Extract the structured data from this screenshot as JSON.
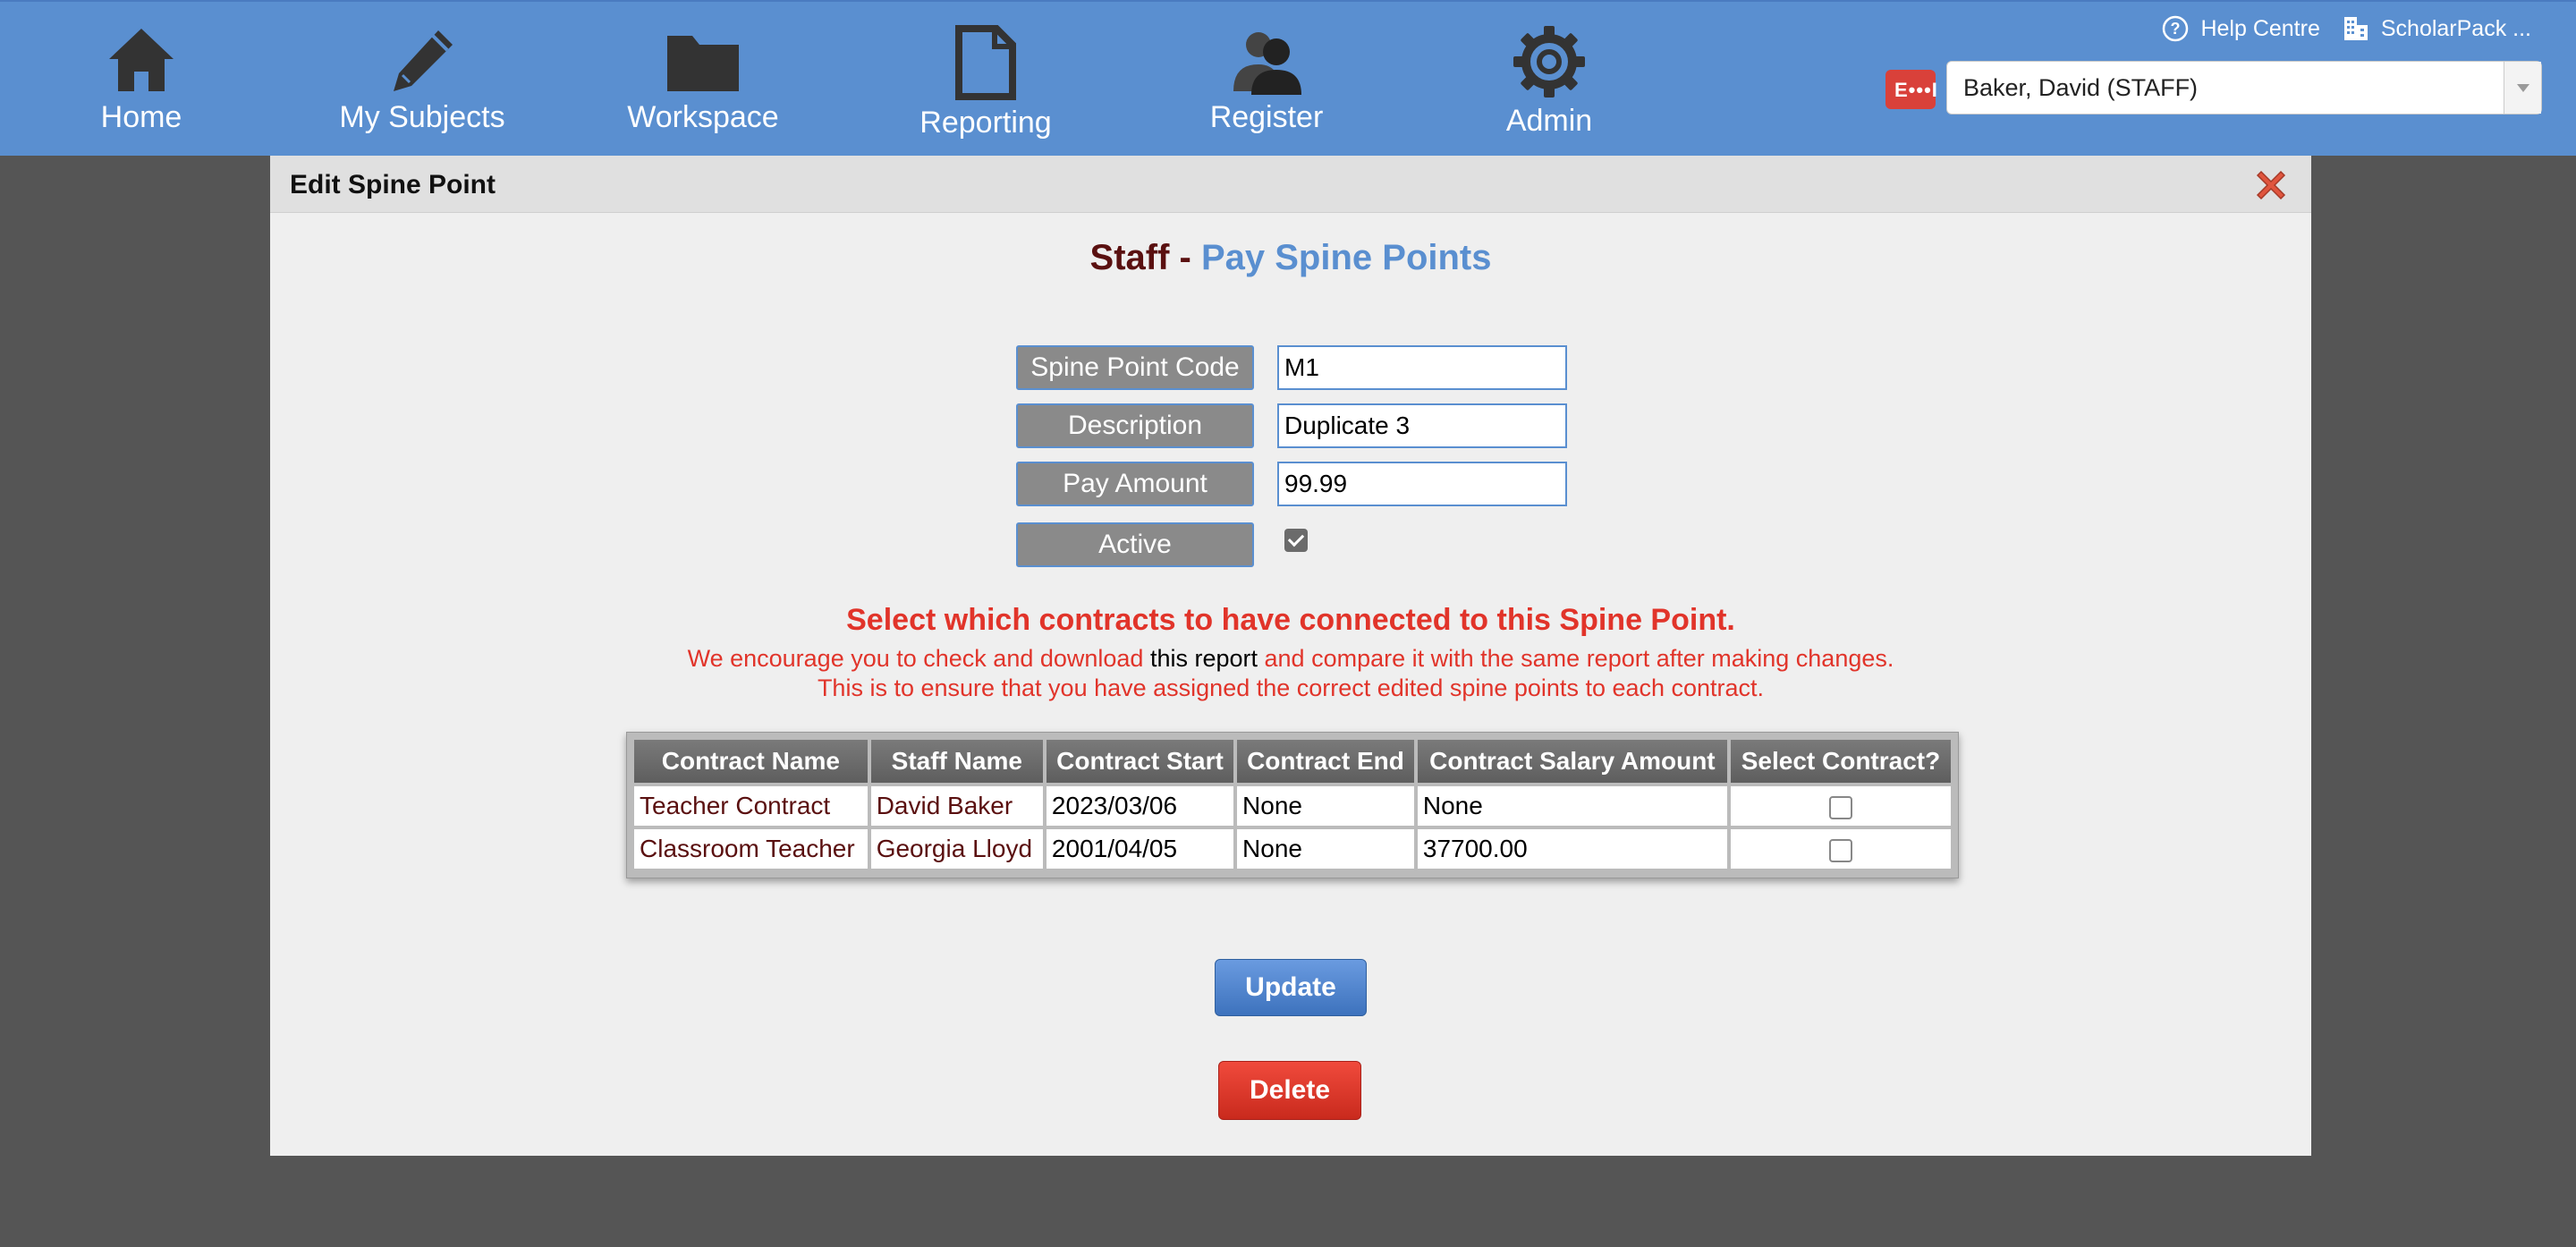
{
  "nav": {
    "items": [
      {
        "label": "Home",
        "icon": "home-icon"
      },
      {
        "label": "My Subjects",
        "icon": "pencil-icon"
      },
      {
        "label": "Workspace",
        "icon": "folder-icon"
      },
      {
        "label": "Reporting",
        "icon": "document-icon"
      },
      {
        "label": "Register",
        "icon": "users-icon"
      },
      {
        "label": "Admin",
        "icon": "gear-icon"
      }
    ],
    "help_label": "Help Centre",
    "school_label": "ScholarPack ...",
    "user_select_value": "Baker, David (STAFF)"
  },
  "modal": {
    "title": "Edit Spine Point",
    "page_title_part1": "Staff - ",
    "page_title_part2": "Pay Spine Points"
  },
  "form": {
    "code_label": "Spine Point Code",
    "code_value": "M1",
    "description_label": "Description",
    "description_value": "Duplicate 3",
    "pay_label": "Pay Amount",
    "pay_value": "99.99",
    "active_label": "Active",
    "active_checked": true
  },
  "notice": {
    "title": "Select which contracts to have connected to this Spine Point.",
    "line1_pre": "We encourage you to check and download ",
    "line1_link": "this report",
    "line1_post": " and compare it with the same report after making changes.",
    "line2": "This is to ensure that you have assigned the correct edited spine points to each contract."
  },
  "table": {
    "headers": [
      "Contract Name",
      "Staff Name",
      "Contract Start",
      "Contract End",
      "Contract Salary Amount",
      "Select Contract?"
    ],
    "rows": [
      [
        "Teacher Contract",
        "David Baker",
        "2023/03/06",
        "None",
        "None"
      ],
      [
        "Classroom Teacher",
        "Georgia Lloyd",
        "2001/04/05",
        "None",
        "37700.00"
      ]
    ]
  },
  "buttons": {
    "update": "Update",
    "delete": "Delete"
  },
  "colors": {
    "nav_bg": "#5a8fd0",
    "accent_red": "#e1342a",
    "title_dark": "#5a1010"
  }
}
